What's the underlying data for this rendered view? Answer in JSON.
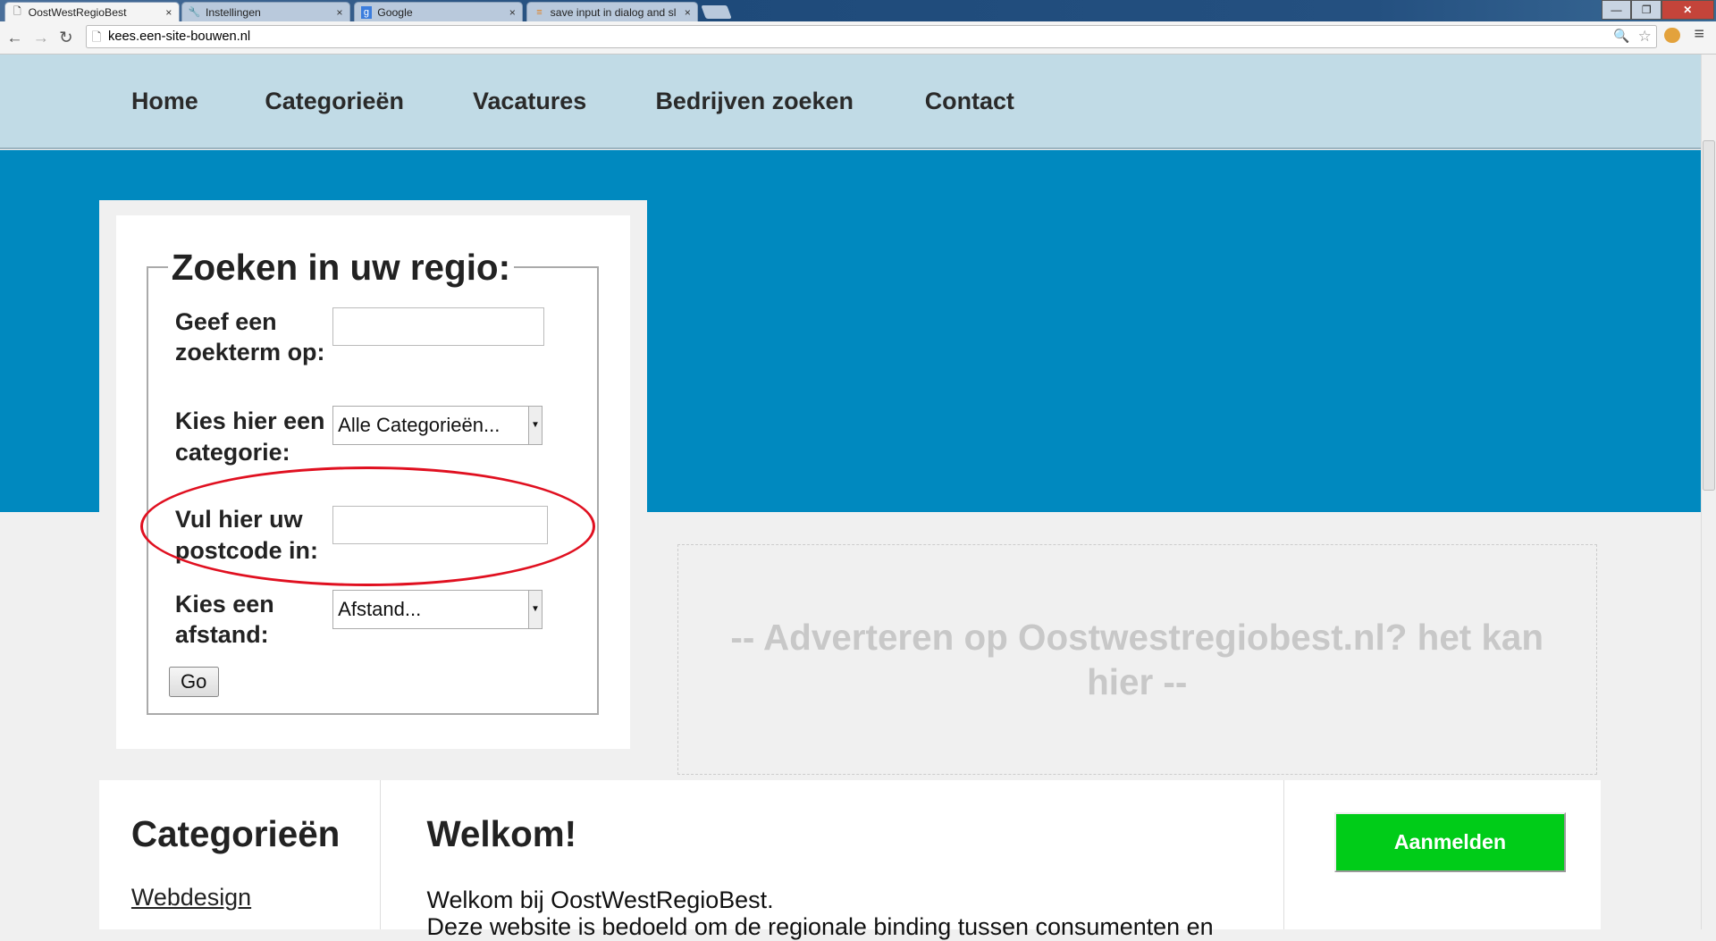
{
  "browser": {
    "tabs": [
      {
        "label": "OostWestRegioBest",
        "icon": "page-icon",
        "active": true
      },
      {
        "label": "Instellingen",
        "icon": "wrench-icon",
        "active": false
      },
      {
        "label": "Google",
        "icon": "google-icon",
        "active": false
      },
      {
        "label": "save input in dialog and sl",
        "icon": "stackoverflow-icon",
        "active": false
      }
    ],
    "tab_close": "×",
    "url": "kees.een-site-bouwen.nl"
  },
  "nav": {
    "items": [
      "Home",
      "Categorieën",
      "Vacatures",
      "Bedrijven zoeken",
      "Contact"
    ]
  },
  "search": {
    "legend": "Zoeken in uw regio:",
    "term_label": "Geef een zoekterm op:",
    "term_value": "",
    "category_label": "Kies hier een categorie:",
    "category_value": "Alle Categorieën...",
    "postcode_label": "Vul hier uw postcode in:",
    "postcode_value": "",
    "distance_label": "Kies een afstand:",
    "distance_value": "Afstand...",
    "go_label": "Go",
    "annotation_color": "#e01020"
  },
  "ad": {
    "text": "-- Adverteren op Oostwestregiobest.nl? het kan hier --"
  },
  "categories": {
    "title": "Categorieën",
    "items": [
      "Webdesign"
    ]
  },
  "welcome": {
    "title": "Welkom!",
    "line1": "Welkom bij OostWestRegioBest.",
    "line2": "Deze website is bedoeld om de regionale binding tussen consumenten en"
  },
  "signup": {
    "label": "Aanmelden",
    "color": "#00cc18"
  },
  "colors": {
    "hero": "#0089bf",
    "nav": "#c1dbe6"
  }
}
